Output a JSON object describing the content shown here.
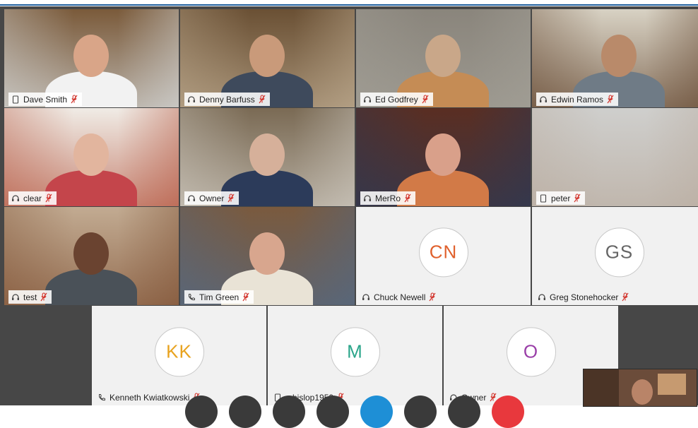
{
  "participants": [
    {
      "name": "Dave Smith",
      "device": "phone-icon",
      "muted": true,
      "type": "video",
      "colors": {
        "bg": "#7a5a3a",
        "accent": "#dfe6ea",
        "skin": "#d9a588",
        "shirt": "#f2f2f2"
      }
    },
    {
      "name": "Denny Barfuss",
      "device": "headset-icon",
      "muted": true,
      "type": "video",
      "colors": {
        "bg": "#6a5034",
        "accent": "#c7b59a",
        "skin": "#c99a7a",
        "shirt": "#3e4a5c"
      }
    },
    {
      "name": "Ed Godfrey",
      "device": "headset-icon",
      "muted": true,
      "type": "video",
      "colors": {
        "bg": "#8a857c",
        "accent": "#a6a39a",
        "skin": "#c9a789",
        "shirt": "#c58c55"
      }
    },
    {
      "name": "Edwin Ramos",
      "device": "headset-icon",
      "muted": true,
      "type": "video",
      "colors": {
        "bg": "#d8d2c4",
        "accent": "#5a3a22",
        "skin": "#b98a6a",
        "shirt": "#6f7b86"
      }
    },
    {
      "name": "clear",
      "device": "headset-icon",
      "muted": true,
      "type": "video",
      "colors": {
        "bg": "#f0ece6",
        "accent": "#b04a32",
        "skin": "#e2b59e",
        "shirt": "#c4454b"
      }
    },
    {
      "name": "Owner",
      "device": "headset-icon",
      "muted": true,
      "type": "video",
      "colors": {
        "bg": "#7a6a54",
        "accent": "#d8d4cc",
        "skin": "#d6b09a",
        "shirt": "#2c3b5a"
      }
    },
    {
      "name": "MerRo",
      "device": "headset-icon",
      "muted": true,
      "type": "video",
      "colors": {
        "bg": "#5a2e22",
        "accent": "#2a3a58",
        "skin": "#d9a08a",
        "shirt": "#d27a47"
      }
    },
    {
      "name": "peter",
      "device": "phone-icon",
      "muted": true,
      "type": "video",
      "colors": {
        "bg": "#cfcfcd",
        "accent": "#b7a89a",
        "skin": "#cfcfcd",
        "shirt": "#cfcfcd"
      }
    },
    {
      "name": "test",
      "device": "headset-icon",
      "muted": true,
      "type": "video",
      "colors": {
        "bg": "#c2ab92",
        "accent": "#7a4a2c",
        "skin": "#6a4330",
        "shirt": "#4a5158"
      }
    },
    {
      "name": "Tim Green",
      "device": "phone-handset-icon",
      "muted": true,
      "type": "video",
      "colors": {
        "bg": "#7a5a3e",
        "accent": "#4f6a8a",
        "skin": "#d8a68e",
        "shirt": "#e9e3d6"
      }
    },
    {
      "name": "Chuck Newell",
      "device": "headset-icon",
      "muted": true,
      "type": "avatar",
      "initials": "CN",
      "initials_color": "#e0612d"
    },
    {
      "name": "Greg Stonehocker",
      "device": "headset-icon",
      "muted": true,
      "type": "avatar",
      "initials": "GS",
      "initials_color": "#666666"
    },
    {
      "name": "Kenneth Kwiatkowski",
      "device": "phone-handset-icon",
      "muted": true,
      "type": "avatar",
      "initials": "KK",
      "initials_color": "#e8a320"
    },
    {
      "name": "mbislop1950",
      "device": "phone-icon",
      "muted": true,
      "type": "avatar",
      "initials": "M",
      "initials_color": "#2ba58a"
    },
    {
      "name": "Owner",
      "device": "headset-icon",
      "muted": true,
      "type": "avatar",
      "initials": "O",
      "initials_color": "#9a3fa8"
    }
  ],
  "controls": [
    {
      "name": "control-1",
      "color": "#3a3a3a"
    },
    {
      "name": "control-2",
      "color": "#3a3a3a"
    },
    {
      "name": "control-3",
      "color": "#3a3a3a"
    },
    {
      "name": "control-4",
      "color": "#3a3a3a"
    },
    {
      "name": "control-5",
      "color": "#1e8fd6"
    },
    {
      "name": "control-6",
      "color": "#3a3a3a"
    },
    {
      "name": "control-7",
      "color": "#3a3a3a"
    },
    {
      "name": "control-8",
      "color": "#e8383d"
    }
  ],
  "theme": {
    "header_line": "#1f5f9e",
    "mute_red": "#d2332b",
    "stage": "#474747"
  }
}
